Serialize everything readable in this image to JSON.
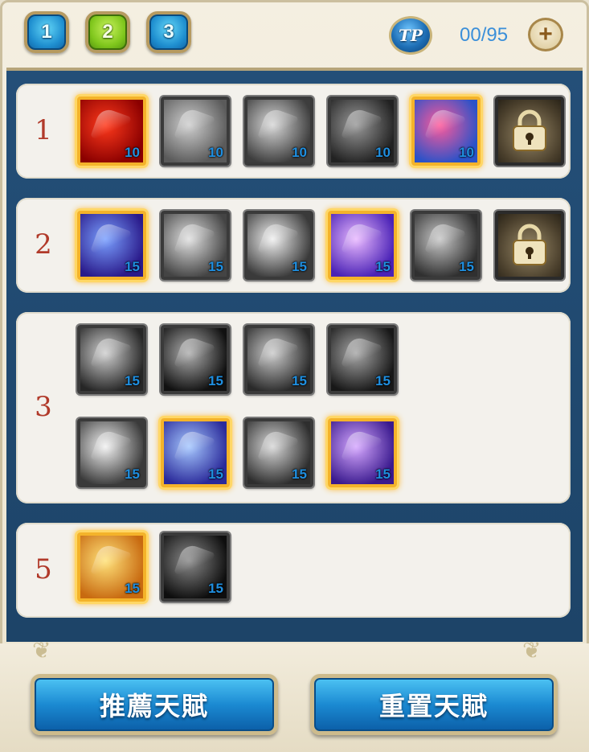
{
  "tabs": [
    {
      "label": "1",
      "active": false
    },
    {
      "label": "2",
      "active": true
    },
    {
      "label": "3",
      "active": false
    }
  ],
  "tp": {
    "icon_label": "TP",
    "count": "00/95",
    "plus_symbol": "+"
  },
  "rows": [
    {
      "label": "1",
      "skills": [
        {
          "icon": "flame-slash-icon",
          "level": "10",
          "active": true,
          "colors": [
            "#ff3a1c",
            "#8b0000"
          ]
        },
        {
          "icon": "armor-chest-icon",
          "level": "10",
          "active": false,
          "colors": [
            "#cfcfcf",
            "#5a5a5a"
          ]
        },
        {
          "icon": "spiked-gauntlet-icon",
          "level": "10",
          "active": false,
          "colors": [
            "#d8d8d8",
            "#3d3d3d"
          ]
        },
        {
          "icon": "warrior-figure-icon",
          "level": "10",
          "active": false,
          "colors": [
            "#9a9a9a",
            "#222222"
          ]
        },
        {
          "icon": "shield-burst-icon",
          "level": "10",
          "active": true,
          "colors": [
            "#ff5a9a",
            "#2a52c8"
          ]
        },
        {
          "icon": "padlock-icon",
          "level": "",
          "active": false,
          "locked": true
        }
      ]
    },
    {
      "label": "2",
      "skills": [
        {
          "icon": "blade-wing-icon",
          "level": "15",
          "active": true,
          "colors": [
            "#7aa0ff",
            "#2a1a8a"
          ]
        },
        {
          "icon": "dash-runner-icon",
          "level": "15",
          "active": false,
          "colors": [
            "#e0e0e0",
            "#444444"
          ]
        },
        {
          "icon": "crescent-slash-icon",
          "level": "15",
          "active": false,
          "colors": [
            "#f0f0f0",
            "#3a3a3a"
          ]
        },
        {
          "icon": "star-burst-icon",
          "level": "15",
          "active": true,
          "colors": [
            "#e9b8ff",
            "#4a22b6"
          ]
        },
        {
          "icon": "chain-target-icon",
          "level": "15",
          "active": false,
          "colors": [
            "#c8c8c8",
            "#303030"
          ]
        },
        {
          "icon": "padlock-icon",
          "level": "",
          "active": false,
          "locked": true
        }
      ]
    },
    {
      "label": "3",
      "skills": [
        {
          "icon": "vortex-slash-icon",
          "level": "15",
          "active": false,
          "colors": [
            "#d0d0d0",
            "#262626"
          ]
        },
        {
          "icon": "dark-vortex-icon",
          "level": "15",
          "active": false,
          "colors": [
            "#b0b0b0",
            "#111111"
          ]
        },
        {
          "icon": "crossed-blades-icon",
          "level": "15",
          "active": false,
          "colors": [
            "#cccccc",
            "#2a2a2a"
          ]
        },
        {
          "icon": "shadow-warrior-icon",
          "level": "15",
          "active": false,
          "colors": [
            "#a8a8a8",
            "#181818"
          ]
        },
        {
          "icon": "shatter-burst-icon",
          "level": "15",
          "active": false,
          "colors": [
            "#f2f2f2",
            "#3a3a3a"
          ]
        },
        {
          "icon": "blue-vortex-icon",
          "level": "15",
          "active": true,
          "colors": [
            "#a6c8ff",
            "#2a2a9a"
          ]
        },
        {
          "icon": "sword-cross-icon",
          "level": "15",
          "active": false,
          "colors": [
            "#d8d8d8",
            "#2e2e2e"
          ]
        },
        {
          "icon": "purple-sword-icon",
          "level": "15",
          "active": true,
          "colors": [
            "#d6a8ff",
            "#3a1a8e"
          ]
        }
      ]
    },
    {
      "label": "5",
      "skills": [
        {
          "icon": "golden-blast-icon",
          "level": "15",
          "active": true,
          "colors": [
            "#ffe27a",
            "#c86a10"
          ]
        },
        {
          "icon": "shadow-beast-icon",
          "level": "15",
          "active": false,
          "colors": [
            "#8a8a8a",
            "#0e0e0e"
          ]
        }
      ]
    }
  ],
  "buttons": {
    "recommend_label": "推薦天賦",
    "reset_label": "重置天賦"
  },
  "colors": {
    "accent_blue": "#1b8ad2",
    "row_label_red": "#b13a2a",
    "active_gold": "#f4b32a",
    "board_blue": "#244f78"
  }
}
